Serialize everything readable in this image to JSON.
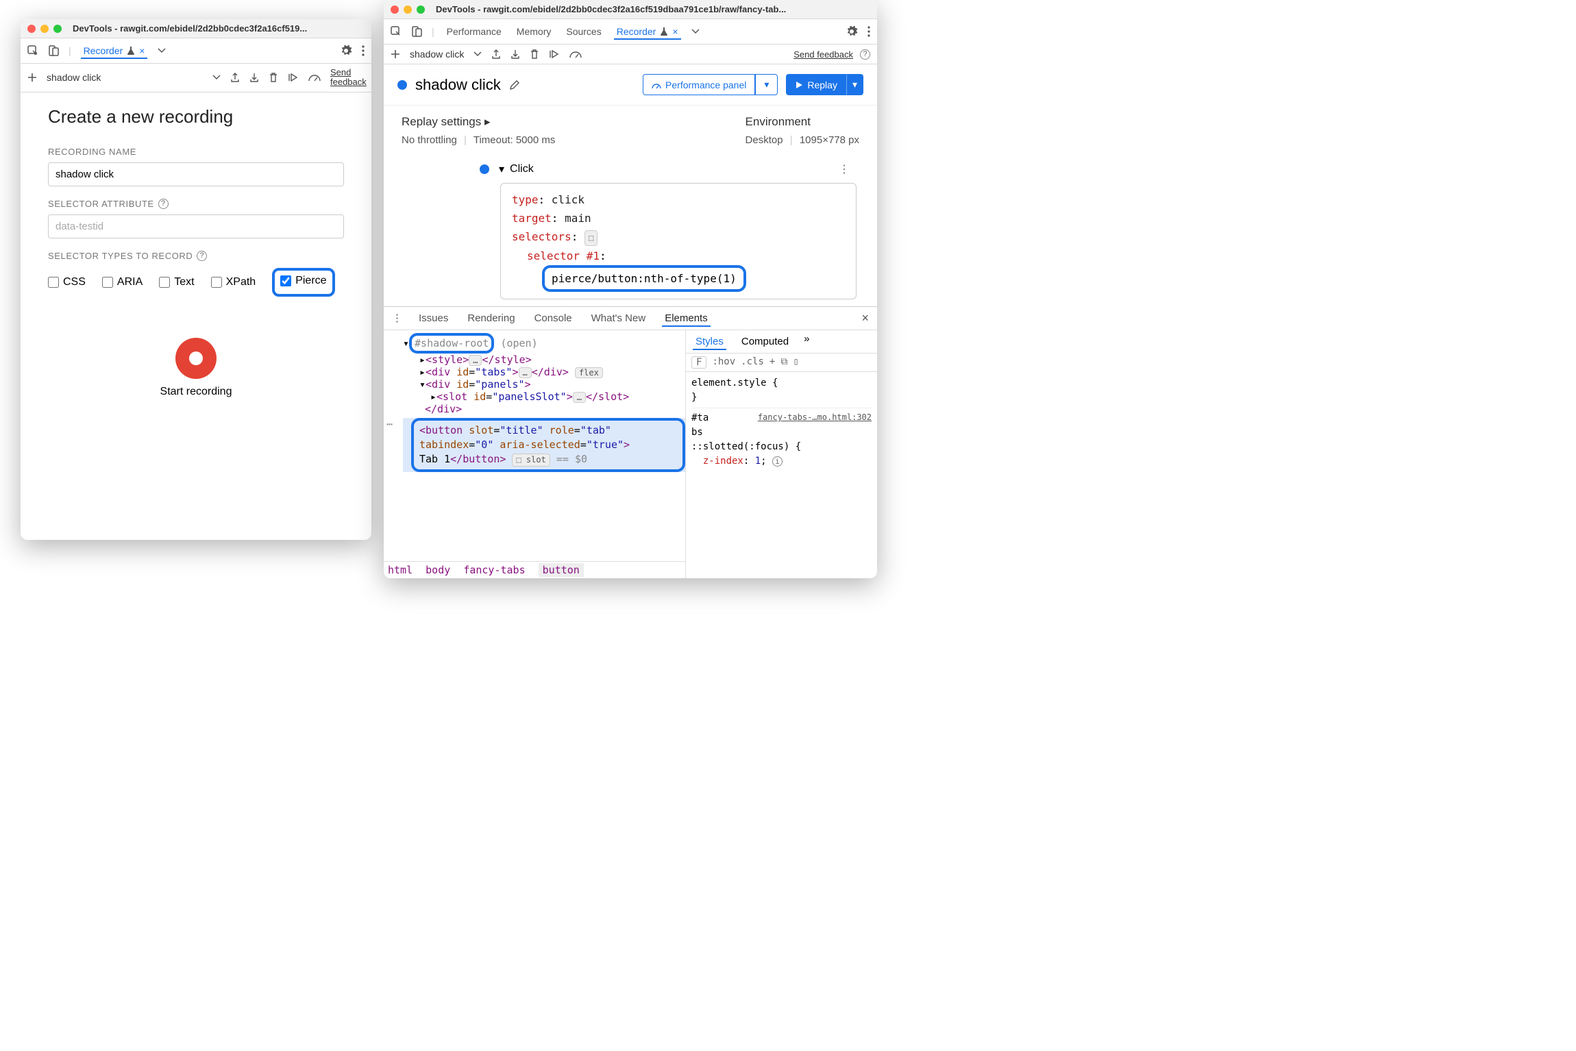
{
  "window1": {
    "title": "DevTools - rawgit.com/ebidel/2d2bb0cdec3f2a16cf519...",
    "tabs": {
      "recorder": "Recorder"
    },
    "toolbar": {
      "name": "shadow click",
      "feedback": "Send feedback"
    },
    "form": {
      "heading": "Create a new recording",
      "name_label": "RECORDING NAME",
      "name_value": "shadow click",
      "selattr_label": "SELECTOR ATTRIBUTE",
      "selattr_placeholder": "data-testid",
      "seltypes_label": "SELECTOR TYPES TO RECORD",
      "types": {
        "css": "CSS",
        "aria": "ARIA",
        "text": "Text",
        "xpath": "XPath",
        "pierce": "Pierce"
      },
      "start": "Start recording"
    }
  },
  "window2": {
    "title": "DevTools - rawgit.com/ebidel/2d2bb0cdec3f2a16cf519dbaa791ce1b/raw/fancy-tab...",
    "tabs": {
      "perf": "Performance",
      "memory": "Memory",
      "sources": "Sources",
      "recorder": "Recorder"
    },
    "toolbar": {
      "name": "shadow click",
      "feedback": "Send feedback"
    },
    "header": {
      "title": "shadow click",
      "perf_panel": "Performance panel",
      "replay": "Replay"
    },
    "settings": {
      "replay_label": "Replay settings",
      "throttling": "No throttling",
      "timeout": "Timeout: 5000 ms",
      "env_label": "Environment",
      "env_value": "Desktop",
      "viewport": "1095×778 px"
    },
    "step": {
      "name": "Click",
      "props": {
        "type_k": "type",
        "type_v": "click",
        "target_k": "target",
        "target_v": "main",
        "selectors_k": "selectors",
        "sel1_k": "selector #1",
        "sel1_v": "pierce/button:nth-of-type(1)"
      }
    },
    "drawer": {
      "tabs": {
        "issues": "Issues",
        "rendering": "Rendering",
        "console": "Console",
        "whatsnew": "What's New",
        "elements": "Elements"
      },
      "shadow_root": "#shadow-root",
      "shadow_open": "(open)",
      "line_style_open": "<style>",
      "line_style_close": "</style>",
      "tabs_open": "<div id=\"tabs\">",
      "tabs_close": "</div>",
      "flex": "flex",
      "panels_open": "<div id=\"panels\">",
      "slot_open": "<slot id=\"panelsSlot\">",
      "slot_close": "</slot>",
      "div_close": "</div>",
      "button_line1": "<button slot=\"title\" role=\"tab\"",
      "button_line2": "tabindex=\"0\" aria-selected=\"true\">",
      "button_line3_a": "Tab 1",
      "button_line3_b": "</button>",
      "slot_badge": "slot",
      "eqdollar": "== $0",
      "breadcrumb": {
        "html": "html",
        "body": "body",
        "ft": "fancy-tabs",
        "btn": "button"
      }
    },
    "styles": {
      "tabs": {
        "styles": "Styles",
        "computed": "Computed"
      },
      "filter": "F",
      "hov": ":hov",
      "cls": ".cls",
      "rule1": "element.style {",
      "close": "}",
      "sel2a": "#ta",
      "sel2b": "bs",
      "src": "fancy-tabs-…mo.html:302",
      "rule2": "::slotted(:focus) {",
      "prop": "z-index",
      "val": "1"
    }
  }
}
